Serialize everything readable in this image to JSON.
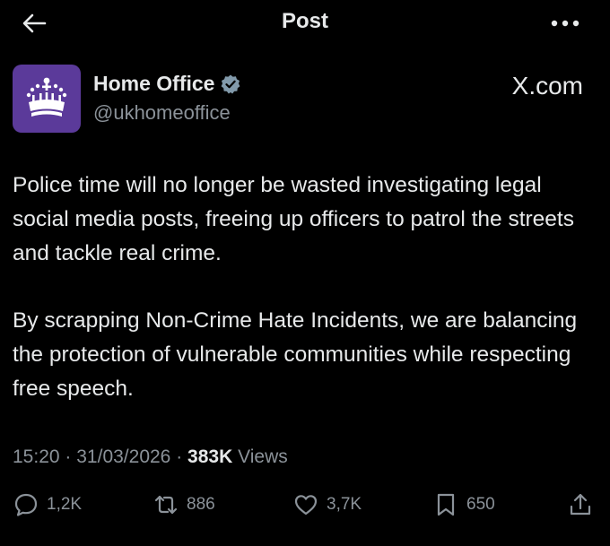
{
  "header": {
    "title": "Post",
    "back_icon": "arrow-left-icon",
    "more_icon": "more-dots-icon"
  },
  "account": {
    "name": "Home Office",
    "handle": "@ukhomeoffice",
    "verified_icon": "verified-badge-icon",
    "avatar_color": "#5b3a9a",
    "watermark": "X.com"
  },
  "post": {
    "paragraphs": [
      "Police time will no longer be wasted investigating legal social media posts, freeing up officers to patrol the streets and tackle real crime.",
      "By scrapping Non-Crime Hate Incidents, we are balancing the protection of vulnerable communities while respecting free speech."
    ],
    "time": "15:20",
    "date": "31/03/2026",
    "separator": "·",
    "views_count": "383K",
    "views_label": "Views"
  },
  "actions": {
    "replies": "1,2K",
    "reposts": "886",
    "likes": "3,7K",
    "bookmarks": "650"
  },
  "colors": {
    "background": "#000000",
    "text": "#e7e9ea",
    "muted": "#8b9299",
    "verified": "#829aab"
  }
}
